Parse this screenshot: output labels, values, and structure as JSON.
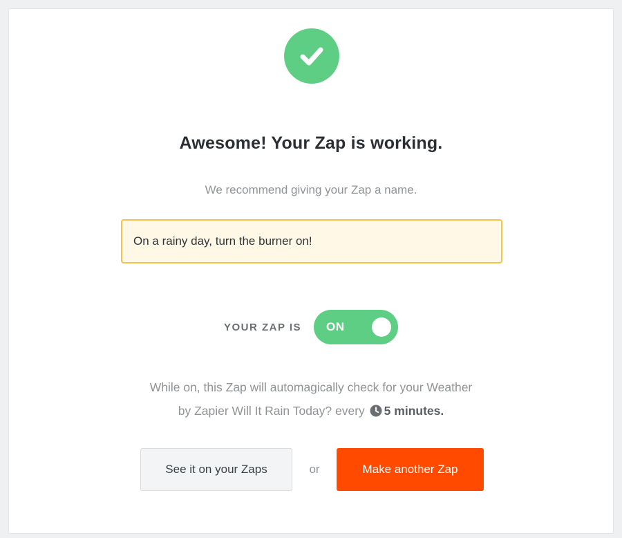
{
  "success": {
    "icon": "checkmark-icon",
    "color": "#5fce85"
  },
  "title": "Awesome! Your Zap is working.",
  "subtitle": "We recommend giving your Zap a name.",
  "zap_name": {
    "value": "On a rainy day, turn the burner on!"
  },
  "status": {
    "label": "YOUR ZAP IS",
    "toggle_text": "ON",
    "is_on": true,
    "color": "#5fce85"
  },
  "description": {
    "line1": "While on, this Zap will automagically check for your Weather",
    "line2_prefix": "by Zapier Will It Rain Today? every",
    "clock_icon": "clock-icon",
    "interval": "5 minutes",
    "interval_suffix": "."
  },
  "actions": {
    "secondary_label": "See it on your Zaps",
    "separator": "or",
    "primary_label": "Make another Zap",
    "primary_color": "#ff4a00"
  }
}
